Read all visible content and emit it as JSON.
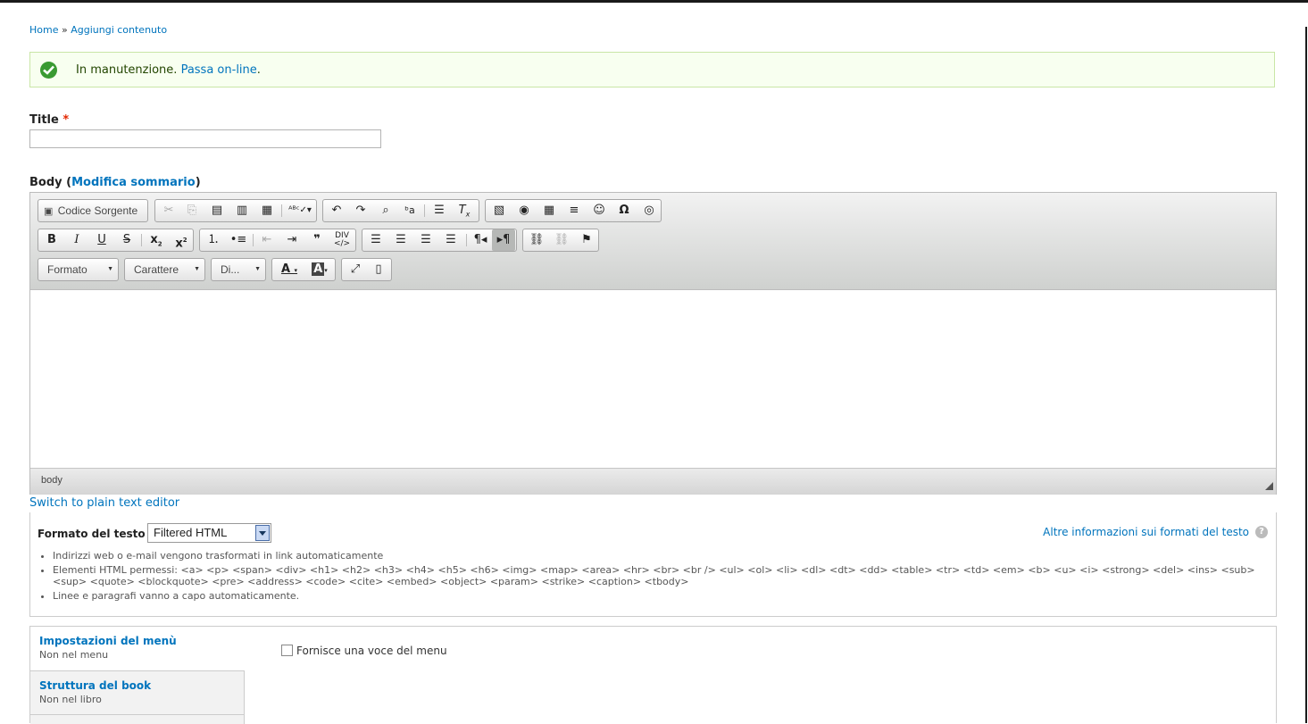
{
  "breadcrumb": {
    "home": "Home",
    "sep": "»",
    "current": "Aggiungi contenuto"
  },
  "message": {
    "text": "In manutenzione.",
    "link": "Passa on-line"
  },
  "title_field": {
    "label": "Title",
    "required": "*"
  },
  "body_field": {
    "label": "Body",
    "summary_link": "Modifica sommario"
  },
  "editor": {
    "source_button": "Codice Sorgente",
    "combos": {
      "format": "Formato",
      "font": "Carattere",
      "size": "Di..."
    },
    "status_path": "body"
  },
  "switch_link": "Switch to plain text editor",
  "text_format": {
    "label": "Formato del testo",
    "selected": "Filtered HTML",
    "more_info": "Altre informazioni sui formati del testo",
    "tips": [
      "Indirizzi web o e-mail vengono trasformati in link automaticamente",
      "Elementi HTML permessi: <a> <p> <span> <div> <h1> <h2> <h3> <h4> <h5> <h6> <img> <map> <area> <hr> <br> <br /> <ul> <ol> <li> <dl> <dt> <dd> <table> <tr> <td> <em> <b> <u> <i> <strong> <del> <ins> <sub> <sup> <quote> <blockquote> <pre> <address> <code> <cite> <embed> <object> <param> <strike> <caption> <tbody>",
      "Linee e paragrafi vanno a capo automaticamente."
    ]
  },
  "vertical_tabs": [
    {
      "title": "Impostazioni del menù",
      "summary": "Non nel menu"
    },
    {
      "title": "Struttura del book",
      "summary": "Non nel libro"
    }
  ],
  "menu_checkbox": "Fornisce una voce del menu"
}
